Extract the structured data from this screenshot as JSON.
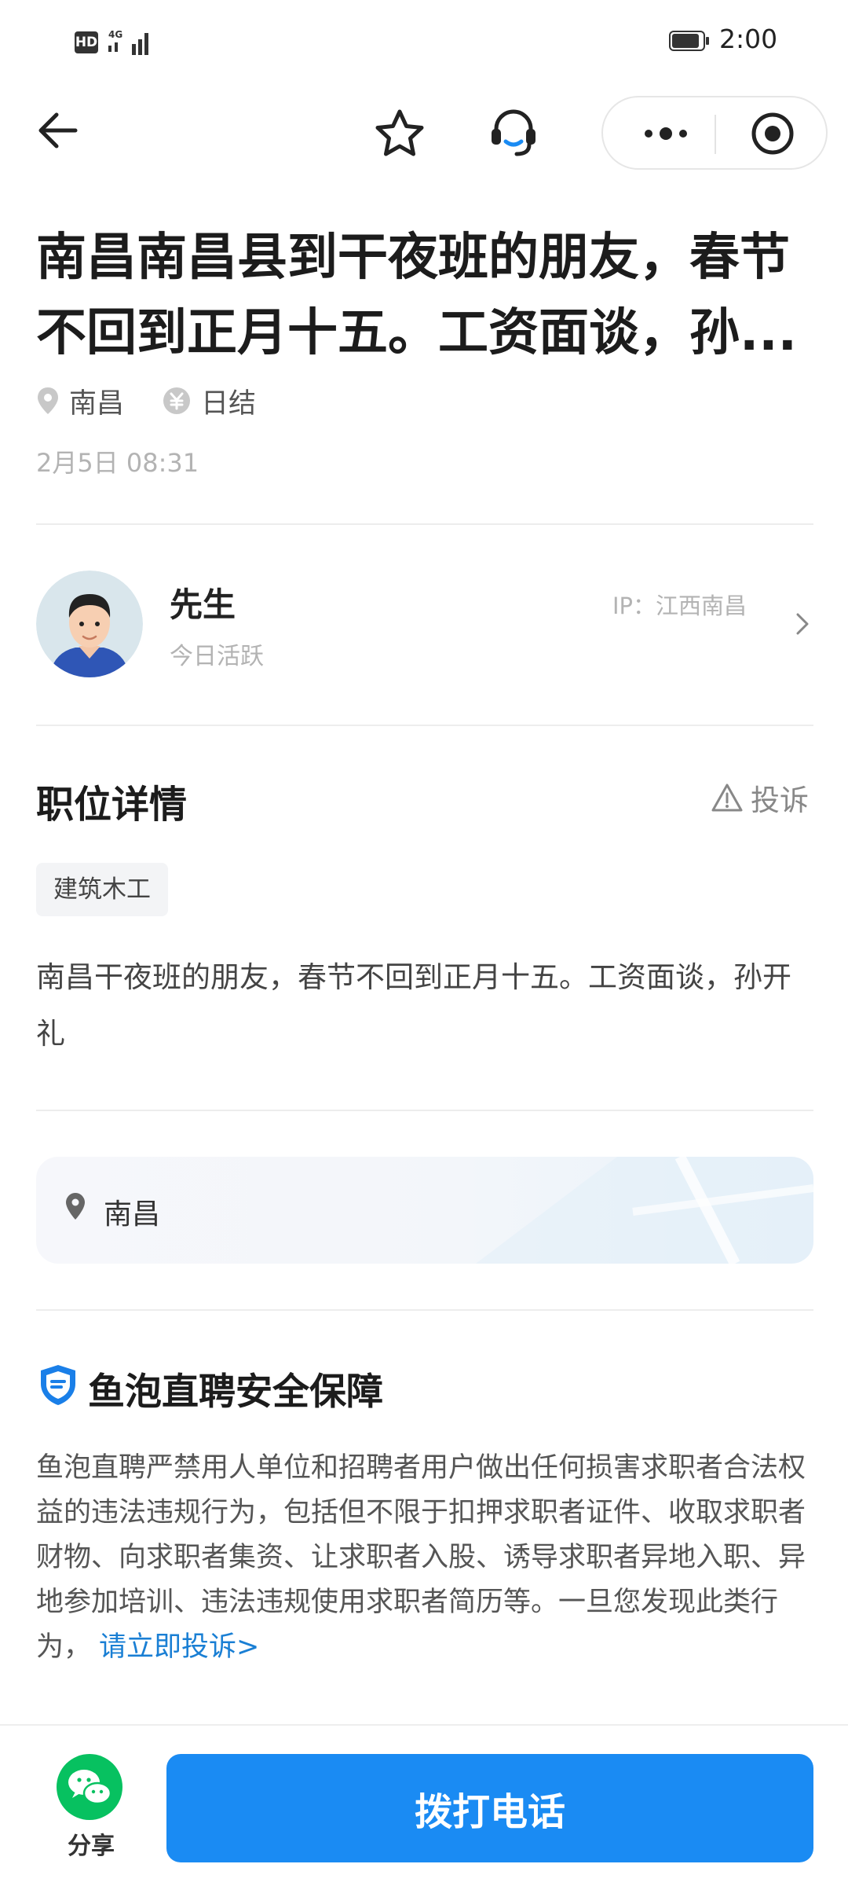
{
  "status_bar": {
    "time": "2:00",
    "hd": "HD",
    "network": "4G"
  },
  "job": {
    "title": "南昌南昌县到干夜班的朋友，春节不回到正月十五。工资面谈，孙...",
    "location": "南昌",
    "pay_type": "日结",
    "posted_time": "2月5日 08:31"
  },
  "publisher": {
    "name": "先生",
    "status": "今日活跃",
    "ip": "IP：江西南昌"
  },
  "details": {
    "section_title": "职位详情",
    "report_label": "投诉",
    "tag": "建筑木工",
    "description": "南昌干夜班的朋友，春节不回到正月十五。工资面谈，孙开礼"
  },
  "location_card": {
    "text": "南昌"
  },
  "safety": {
    "title": "鱼泡直聘安全保障",
    "text": "鱼泡直聘严禁用人单位和招聘者用户做出任何损害求职者合法权益的违法违规行为，包括但不限于扣押求职者证件、收取求职者财物、向求职者集资、让求职者入股、诱导求职者异地入职、异地参加培训、违法违规使用求职者简历等。一旦您发现此类行为，",
    "link": "请立即投诉>"
  },
  "bottom_bar": {
    "share_label": "分享",
    "call_label": "拨打电话"
  },
  "colors": {
    "primary": "#1a8bf3",
    "link": "#1a7fd4",
    "wechat": "#07c160"
  },
  "icons": [
    "back-arrow-icon",
    "star-icon",
    "customer-service-icon",
    "more-icon",
    "close-target-icon",
    "location-pin-icon",
    "currency-icon",
    "warning-icon",
    "shield-icon",
    "wechat-icon"
  ]
}
